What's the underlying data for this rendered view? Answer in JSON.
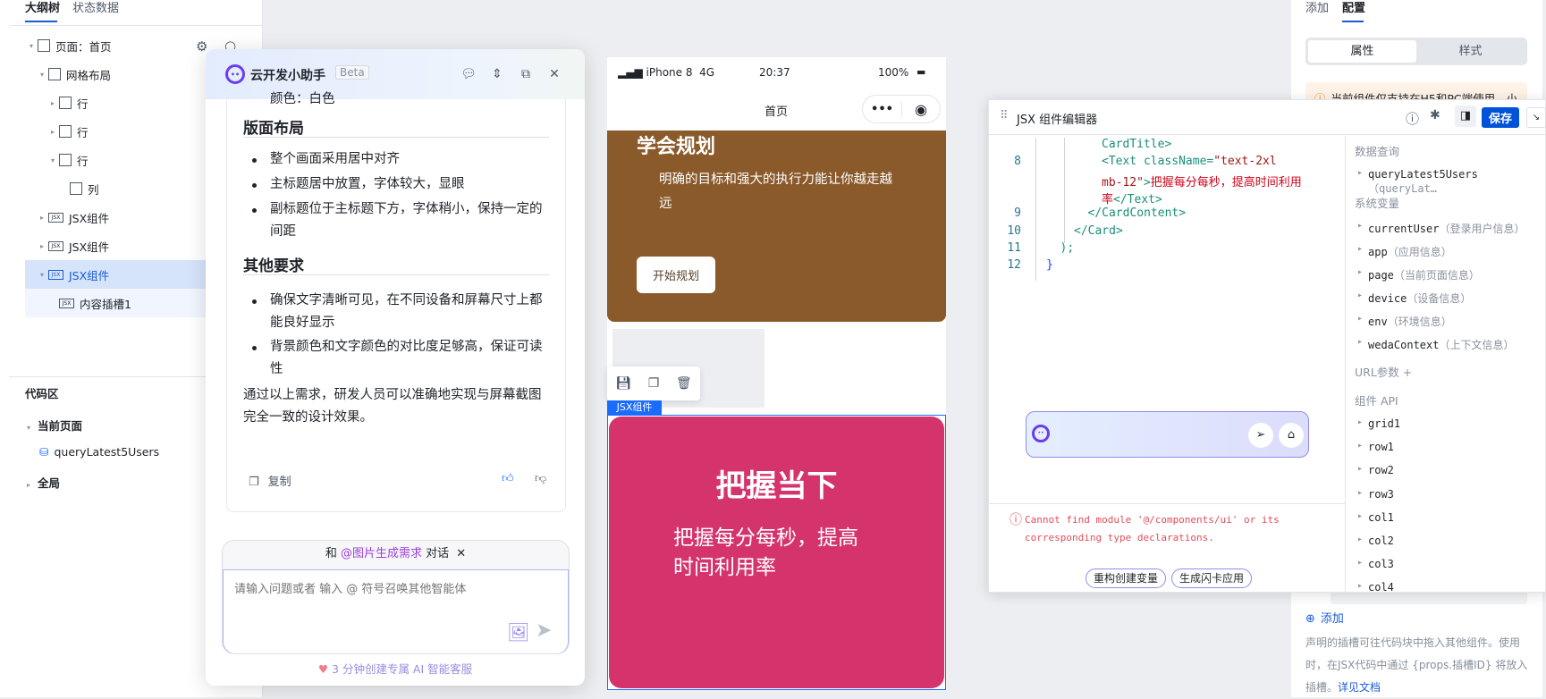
{
  "left": {
    "tabs": [
      "大纲树",
      "状态数据"
    ],
    "tree": [
      {
        "label": "页面：首页",
        "icon": "page-icon",
        "caret": "▾",
        "level": 0
      },
      {
        "label": "网格布局",
        "icon": "grid-icon",
        "caret": "▾",
        "level": 1
      },
      {
        "label": "行",
        "icon": "row-icon",
        "caret": "▸",
        "level": 2
      },
      {
        "label": "行",
        "icon": "row-icon",
        "caret": "▸",
        "level": 2
      },
      {
        "label": "行",
        "icon": "row-icon",
        "caret": "▾",
        "level": 2
      },
      {
        "label": "列",
        "icon": "col-icon",
        "caret": "",
        "level": 3
      },
      {
        "label": "JSX组件",
        "icon": "jsx-icon",
        "caret": "▸",
        "level": 1
      },
      {
        "label": "JSX组件",
        "icon": "jsx-icon",
        "caret": "▸",
        "level": 1
      },
      {
        "label": "JSX组件",
        "icon": "jsx-icon",
        "caret": "▾",
        "level": 1,
        "selected": true
      },
      {
        "label": "内容插槽1",
        "icon": "jsx-icon",
        "caret": "",
        "level": 2,
        "child": true
      }
    ],
    "code_title": "代码区",
    "current_page": "当前页面",
    "query": "queryLatest5Users",
    "global": "全局"
  },
  "chat": {
    "title": "云开发小助手",
    "badge": "Beta",
    "cut_line": "颜色：白色",
    "section1": "版面布局",
    "bullets1": [
      "整个画面采用居中对齐",
      "主标题居中放置，字体较大，显眼",
      "副标题位于主标题下方，字体稍小，保持一定的间距"
    ],
    "section2": "其他要求",
    "bullets2": [
      "确保文字清晰可见，在不同设备和屏幕尺寸上都能良好显示",
      "背景颜色和文字颜色的对比度足够高，保证可读性"
    ],
    "summary": "通过以上需求，研发人员可以准确地实现与屏幕截图完全一致的设计效果。",
    "copy": "复制",
    "context_prefix": "和",
    "context_agent": "@图片生成需求",
    "context_suffix": "对话",
    "placeholder": "请输入问题或者 输入 @ 符号召唤其他智能体",
    "footer": "3 分钟创建专属 AI 智能客服"
  },
  "phone": {
    "carrier": "iPhone 8",
    "network": "4G",
    "time": "20:37",
    "battery": "100%",
    "nav_title": "首页",
    "card1": {
      "title": "学会规划",
      "subtitle": "明确的目标和强大的执行力能让你越走越远",
      "button": "开始规划",
      "color": "#8a5a2b"
    },
    "tag": "JSX组件",
    "card2": {
      "title": "把握当下",
      "subtitle": "把握每分每秒，提高时间利用率",
      "color": "#d5336b"
    }
  },
  "editor": {
    "title": "JSX 组件编辑器",
    "save": "保存",
    "lines": [
      {
        "n": "",
        "parts": [
          [
            "CardTitle>",
            "tag"
          ]
        ],
        "indent": 4
      },
      {
        "n": "8",
        "parts": [
          [
            "<Text ",
            "tag"
          ],
          [
            "className=",
            "attr"
          ],
          [
            "\"text-2xl",
            "str"
          ]
        ],
        "indent": 4
      },
      {
        "n": "",
        "parts": [
          [
            "mb-12\"",
            "str"
          ],
          [
            ">",
            "tag"
          ],
          [
            "把握每分每秒，提高时间利用",
            "txt"
          ]
        ],
        "indent": 4
      },
      {
        "n": "",
        "parts": [
          [
            "率",
            "txt"
          ],
          [
            "</Text>",
            "tag"
          ]
        ],
        "indent": 4
      },
      {
        "n": "9",
        "parts": [
          [
            "</CardContent>",
            "tag"
          ]
        ],
        "indent": 3
      },
      {
        "n": "10",
        "parts": [
          [
            "</Card>",
            "tag"
          ]
        ],
        "indent": 2
      },
      {
        "n": "11",
        "parts": [
          [
            ");",
            "punc"
          ]
        ],
        "indent": 1
      },
      {
        "n": "12",
        "parts": [
          [
            "}",
            "brace"
          ]
        ],
        "indent": 0
      }
    ],
    "chips": [
      "重构创建变量",
      "生成闪卡应用"
    ],
    "error": "Cannot find module '@/components/ui' or its corresponding type declarations.",
    "side": {
      "data_query": "数据查询",
      "query_item": "queryLatest5Users",
      "query_hint": "（queryLat…",
      "sys_vars": "系统变量",
      "vars": [
        [
          "currentUser",
          "（登录用户信息）"
        ],
        [
          "app",
          "（应用信息）"
        ],
        [
          "page",
          "（当前页面信息）"
        ],
        [
          "device",
          "（设备信息）"
        ],
        [
          "env",
          "（环境信息）"
        ],
        [
          "wedaContext",
          "（上下文信息）"
        ]
      ],
      "url_params": "URL参数",
      "component_api": "组件 API",
      "apis": [
        "grid1",
        "row1",
        "row2",
        "row3",
        "col1",
        "col2",
        "col3",
        "col4"
      ]
    }
  },
  "right": {
    "tabs": [
      "添加",
      "配置"
    ],
    "segments": [
      "属性",
      "样式"
    ],
    "warning": "当前组件仅支持在H5和PC端使用，小",
    "add": "添加",
    "desc": "声明的插槽可往代码块中拖入其他组件。使用时，在JSX代码中通过 {props.插槽ID} 将放入插槽。",
    "doc_link": "详见文档"
  }
}
